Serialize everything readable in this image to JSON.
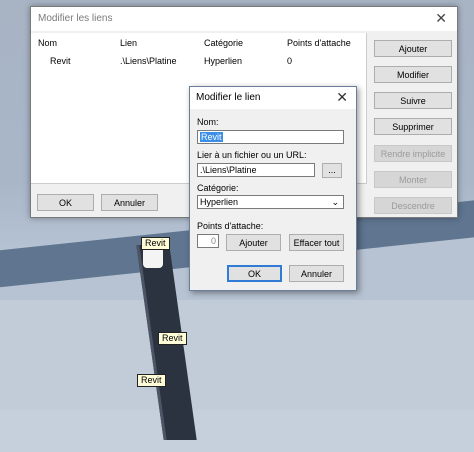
{
  "dialog_links": {
    "title": "Modifier les liens",
    "close_glyph": "✕",
    "columns": [
      "Nom",
      "Lien",
      "Catégorie",
      "Points d'attache"
    ],
    "rows": [
      {
        "name": "Revit",
        "link": ".\\Liens\\Platine",
        "category": "Hyperlien",
        "points": "0"
      }
    ],
    "buttons": {
      "add": "Ajouter",
      "edit": "Modifier",
      "next": "Suivre",
      "delete": "Supprimer",
      "implicit": "Rendre implicite",
      "up": "Monter",
      "down": "Descendre",
      "ok": "OK",
      "cancel": "Annuler"
    }
  },
  "dialog_edit": {
    "title": "Modifier le lien",
    "close_glyph": "✕",
    "name_label": "Nom:",
    "name_value": "Revit",
    "url_label": "Lier à un fichier ou un URL:",
    "url_value": ".\\Liens\\Platine",
    "browse_label": "...",
    "category_label": "Catégorie:",
    "category_value": "Hyperlien",
    "points_label": "Points d'attache:",
    "points_value": "0",
    "add_label": "Ajouter",
    "clear_label": "Effacer tout",
    "ok_label": "OK",
    "cancel_label": "Annuler"
  },
  "scene_tags": [
    "Revit",
    "Revit",
    "Revit"
  ]
}
